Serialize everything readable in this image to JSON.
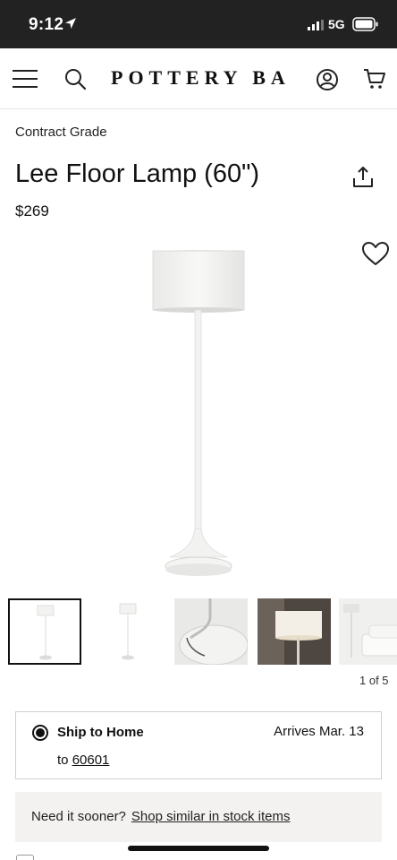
{
  "status_bar": {
    "time": "9:12",
    "network": "5G",
    "location_icon": "location-arrow-icon",
    "signal_icon": "signal-icon",
    "battery_icon": "battery-icon"
  },
  "header": {
    "brand": "POTTERY BARN",
    "menu_icon": "hamburger-icon",
    "search_icon": "search-icon",
    "account_icon": "account-icon",
    "cart_icon": "cart-icon"
  },
  "product": {
    "category": "Contract Grade",
    "title": "Lee Floor Lamp (60\")",
    "price": "$269",
    "share_icon": "share-icon",
    "wishlist_icon": "heart-icon"
  },
  "gallery": {
    "counter": "1 of 5",
    "thumbnail_count": 5,
    "active_index": 0
  },
  "shipping": {
    "label": "Ship to Home",
    "arrival": "Arrives Mar. 13",
    "to_prefix": "to",
    "zip": "60601",
    "selected": true
  },
  "sooner": {
    "prompt": "Need it sooner?",
    "link": "Shop similar in stock items"
  },
  "colors": {
    "status_bar_bg": "#222222",
    "sooner_bg": "#f4f2f1",
    "text": "#111111"
  }
}
